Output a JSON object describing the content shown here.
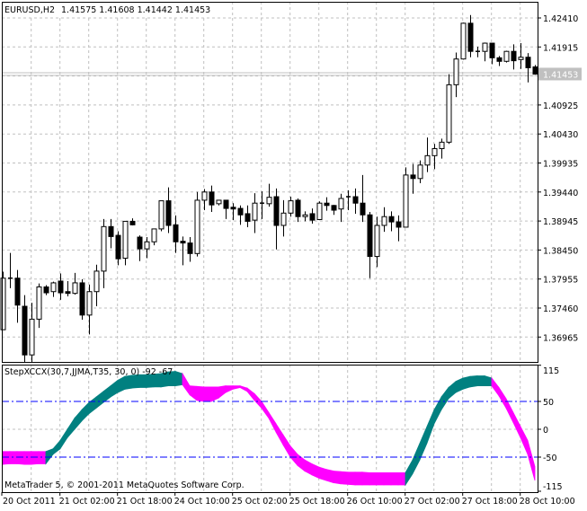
{
  "header": {
    "symbol": "EURUSD,H2",
    "ohlc": "1.41575 1.41608 1.41442 1.41453"
  },
  "indicator": {
    "label": "StepXCCX(30,7,JJMA,T35, 30, 0) -92 -67",
    "copyright": "MetaTrader 5, © 2001-2011 MetaQuotes Software Corp."
  },
  "colors": {
    "up": "#008080",
    "down": "#FF00FF",
    "levels": "#0000FF",
    "grid": "#C0C0C0",
    "bid": "#C0C0C0"
  },
  "chart_data": [
    {
      "type": "candlestick",
      "title": "EURUSD,H2",
      "ylim": [
        1.3649,
        1.4265
      ],
      "bid": 1.41453,
      "bid_label": "1.41453",
      "y_ticks": [
        1.4241,
        1.41915,
        1.4142,
        1.40925,
        1.4043,
        1.39935,
        1.3944,
        1.38945,
        1.3845,
        1.37955,
        1.3746,
        1.36965
      ],
      "y_tick_labels": [
        "1.42410",
        "1.41915",
        "",
        "1.40925",
        "1.40430",
        "1.39935",
        "1.39440",
        "1.38945",
        "1.38450",
        "1.37955",
        "1.37460",
        "1.36965"
      ],
      "x_labels": [
        "20 Oct 2011",
        "21 Oct 02:00",
        "21 Oct 18:00",
        "24 Oct 10:00",
        "25 Oct 02:00",
        "25 Oct 18:00",
        "26 Oct 10:00",
        "27 Oct 02:00",
        "27 Oct 18:00",
        "28 Oct 10:00"
      ],
      "ohlc": [
        [
          1.3709,
          1.3808,
          1.3709,
          1.3797
        ],
        [
          1.3797,
          1.384,
          1.378,
          1.3797
        ],
        [
          1.3797,
          1.3811,
          1.3721,
          1.3751
        ],
        [
          1.3749,
          1.3768,
          1.3653,
          1.3666
        ],
        [
          1.3666,
          1.3755,
          1.3653,
          1.3727
        ],
        [
          1.3727,
          1.3788,
          1.3712,
          1.3782
        ],
        [
          1.3782,
          1.3785,
          1.3768,
          1.3772
        ],
        [
          1.3774,
          1.3791,
          1.3765,
          1.3789
        ],
        [
          1.3792,
          1.3805,
          1.376,
          1.3772
        ],
        [
          1.3774,
          1.3792,
          1.3766,
          1.3771
        ],
        [
          1.3771,
          1.3806,
          1.3769,
          1.3789
        ],
        [
          1.3789,
          1.3795,
          1.3726,
          1.3734
        ],
        [
          1.3734,
          1.3786,
          1.3701,
          1.3774
        ],
        [
          1.3774,
          1.382,
          1.3749,
          1.3809
        ],
        [
          1.3809,
          1.3898,
          1.378,
          1.3885
        ],
        [
          1.3885,
          1.3898,
          1.3848,
          1.3868
        ],
        [
          1.387,
          1.3877,
          1.3819,
          1.383
        ],
        [
          1.3831,
          1.3894,
          1.3819,
          1.3894
        ],
        [
          1.3894,
          1.3899,
          1.3887,
          1.3888
        ],
        [
          1.3867,
          1.387,
          1.3826,
          1.3847
        ],
        [
          1.3847,
          1.3867,
          1.3831,
          1.3859
        ],
        [
          1.3859,
          1.3881,
          1.3853,
          1.3881
        ],
        [
          1.3881,
          1.3929,
          1.3877,
          1.3929
        ],
        [
          1.3929,
          1.3952,
          1.3874,
          1.3887
        ],
        [
          1.3888,
          1.3904,
          1.384,
          1.3859
        ],
        [
          1.386,
          1.3868,
          1.3819,
          1.3857
        ],
        [
          1.3857,
          1.3867,
          1.3825,
          1.3839
        ],
        [
          1.3839,
          1.3944,
          1.3834,
          1.393
        ],
        [
          1.393,
          1.3949,
          1.3913,
          1.3944
        ],
        [
          1.3944,
          1.3955,
          1.391,
          1.3922
        ],
        [
          1.3924,
          1.393,
          1.3921,
          1.393
        ],
        [
          1.393,
          1.393,
          1.3898,
          1.3916
        ],
        [
          1.3918,
          1.3925,
          1.3896,
          1.3915
        ],
        [
          1.3916,
          1.3921,
          1.3888,
          1.3905
        ],
        [
          1.3907,
          1.3921,
          1.3884,
          1.3894
        ],
        [
          1.3896,
          1.3942,
          1.3874,
          1.3925
        ],
        [
          1.3925,
          1.3945,
          1.3898,
          1.3924
        ],
        [
          1.3924,
          1.3958,
          1.3919,
          1.3935
        ],
        [
          1.3936,
          1.395,
          1.3846,
          1.3887
        ],
        [
          1.3887,
          1.393,
          1.3868,
          1.3908
        ],
        [
          1.3908,
          1.3936,
          1.3902,
          1.3929
        ],
        [
          1.393,
          1.3933,
          1.3893,
          1.3902
        ],
        [
          1.3902,
          1.3911,
          1.3894,
          1.3905
        ],
        [
          1.3907,
          1.3916,
          1.389,
          1.3896
        ],
        [
          1.3897,
          1.3928,
          1.3896,
          1.3925
        ],
        [
          1.3925,
          1.3935,
          1.3912,
          1.3921
        ],
        [
          1.3921,
          1.3922,
          1.3905,
          1.3913
        ],
        [
          1.3915,
          1.3941,
          1.3893,
          1.3933
        ],
        [
          1.3936,
          1.3947,
          1.3913,
          1.3935
        ],
        [
          1.3936,
          1.395,
          1.3907,
          1.3925
        ],
        [
          1.3925,
          1.3973,
          1.3893,
          1.3905
        ],
        [
          1.3905,
          1.391,
          1.3797,
          1.3834
        ],
        [
          1.3834,
          1.3902,
          1.3816,
          1.3887
        ],
        [
          1.3887,
          1.3918,
          1.3876,
          1.3902
        ],
        [
          1.3902,
          1.3911,
          1.3877,
          1.3893
        ],
        [
          1.3893,
          1.3904,
          1.386,
          1.3884
        ],
        [
          1.3884,
          1.3986,
          1.3884,
          1.3973
        ],
        [
          1.3973,
          1.3992,
          1.3941,
          1.3967
        ],
        [
          1.3967,
          1.3998,
          1.3959,
          1.399
        ],
        [
          1.399,
          1.4037,
          1.3978,
          1.4006
        ],
        [
          1.4006,
          1.4026,
          1.3983,
          1.4018
        ],
        [
          1.4018,
          1.4035,
          1.4001,
          1.4029
        ],
        [
          1.4029,
          1.4145,
          1.4026,
          1.4127
        ],
        [
          1.4127,
          1.4182,
          1.4106,
          1.4171
        ],
        [
          1.4171,
          1.4233,
          1.417,
          1.4232
        ],
        [
          1.4232,
          1.4246,
          1.4174,
          1.4184
        ],
        [
          1.4184,
          1.4192,
          1.4174,
          1.4184
        ],
        [
          1.4184,
          1.4199,
          1.4167,
          1.4198
        ],
        [
          1.4198,
          1.4198,
          1.4162,
          1.4173
        ],
        [
          1.4173,
          1.4176,
          1.4159,
          1.4167
        ],
        [
          1.4167,
          1.4185,
          1.4165,
          1.4184
        ],
        [
          1.4184,
          1.4196,
          1.4153,
          1.4168
        ],
        [
          1.417,
          1.4198,
          1.4154,
          1.4174
        ],
        [
          1.4174,
          1.4181,
          1.4131,
          1.4156
        ],
        [
          1.41575,
          1.41608,
          1.41442,
          1.41453
        ]
      ]
    },
    {
      "type": "area",
      "title": "StepXCCX(30,7,JJMA,T35, 30, 0)",
      "ylim": [
        -115,
        115
      ],
      "y_tick_labels": [
        "115",
        "50",
        "0",
        "-50",
        "-115"
      ],
      "y_ticks": [
        115,
        50,
        0,
        -50,
        -115
      ],
      "levels": [
        50,
        -50
      ],
      "upper": [
        -40,
        -40,
        -40,
        -40,
        -40,
        -40,
        -40,
        -35,
        -20,
        0,
        20,
        35,
        48,
        58,
        68,
        78,
        88,
        95,
        97,
        98,
        98,
        99,
        100,
        103,
        104,
        100,
        78,
        77,
        76,
        76,
        76,
        78,
        78,
        78,
        74,
        64,
        50,
        30,
        10,
        -10,
        -30,
        -45,
        -55,
        -62,
        -68,
        -72,
        -75,
        -76,
        -77,
        -77,
        -77,
        -78,
        -78,
        -78,
        -78,
        -78,
        -78,
        -55,
        -25,
        5,
        35,
        58,
        75,
        86,
        92,
        95,
        96,
        96,
        92,
        75,
        55,
        30,
        5,
        -20,
        -67
      ],
      "lower": [
        -63,
        -62,
        -62,
        -63,
        -63,
        -62,
        -62,
        -45,
        -35,
        -15,
        0,
        15,
        28,
        38,
        48,
        58,
        66,
        72,
        74,
        75,
        75,
        76,
        76,
        78,
        78,
        80,
        62,
        52,
        50,
        50,
        56,
        66,
        72,
        75,
        68,
        52,
        38,
        20,
        -5,
        -28,
        -50,
        -65,
        -75,
        -82,
        -88,
        -92,
        -96,
        -98,
        -99,
        -100,
        -100,
        -100,
        -100,
        -100,
        -100,
        -100,
        -100,
        -80,
        -55,
        -25,
        10,
        35,
        55,
        66,
        72,
        76,
        78,
        78,
        78,
        60,
        38,
        12,
        -15,
        -45,
        -92
      ],
      "direction": [
        "down",
        "down",
        "down",
        "down",
        "down",
        "down",
        "down",
        "up",
        "up",
        "up",
        "up",
        "up",
        "up",
        "up",
        "up",
        "up",
        "up",
        "up",
        "up",
        "up",
        "up",
        "up",
        "up",
        "up",
        "up",
        "up",
        "down",
        "down",
        "down",
        "down",
        "down",
        "down",
        "down",
        "down",
        "down",
        "down",
        "down",
        "down",
        "down",
        "down",
        "down",
        "down",
        "down",
        "down",
        "down",
        "down",
        "down",
        "down",
        "down",
        "down",
        "down",
        "down",
        "down",
        "down",
        "down",
        "down",
        "down",
        "up",
        "up",
        "up",
        "up",
        "up",
        "up",
        "up",
        "up",
        "up",
        "up",
        "up",
        "up",
        "down",
        "down",
        "down",
        "down",
        "down",
        "down"
      ]
    }
  ]
}
